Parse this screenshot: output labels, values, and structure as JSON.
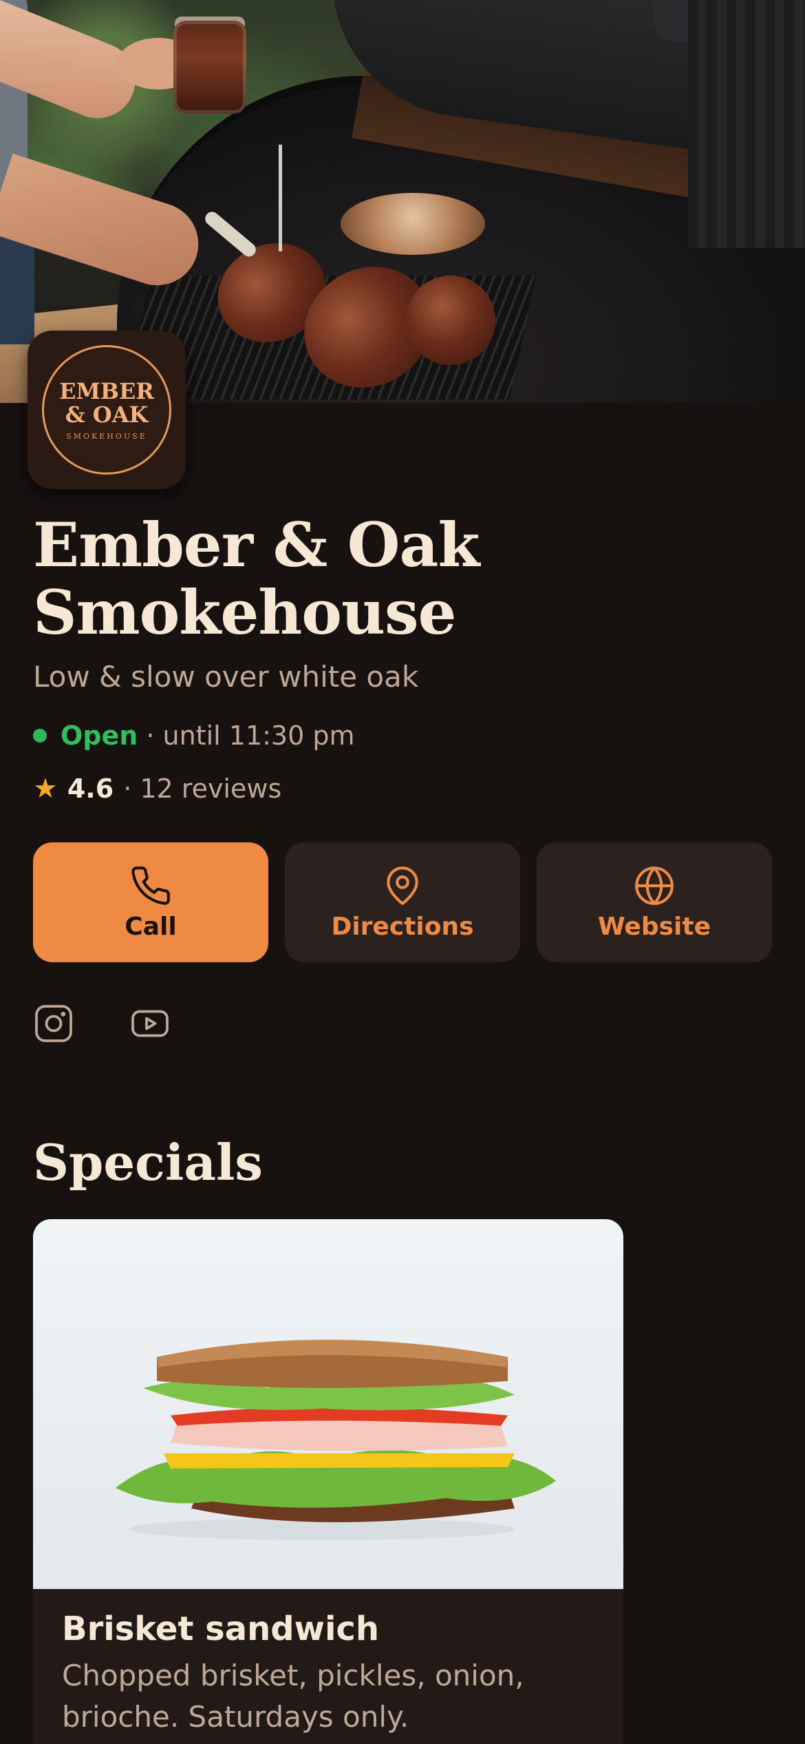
{
  "business": {
    "logo": {
      "line1": "EMBER",
      "line2": "& OAK",
      "line3": "SMOKEHOUSE"
    },
    "name": "Ember & Oak Smokehouse",
    "tagline": "Low & slow over white oak",
    "status": {
      "state": "Open",
      "detail": "· until 11:30 pm",
      "color": "#2fbf5e"
    },
    "rating": {
      "score": "4.6",
      "reviews": "· 12 reviews",
      "star_color": "#f5a623"
    }
  },
  "actions": [
    {
      "label": "Call",
      "icon": "phone-icon"
    },
    {
      "label": "Directions",
      "icon": "map-pin-icon"
    },
    {
      "label": "Website",
      "icon": "globe-icon"
    }
  ],
  "socials": [
    {
      "icon": "instagram-icon"
    },
    {
      "icon": "youtube-icon"
    }
  ],
  "specials": {
    "heading": "Specials",
    "items": [
      {
        "title": "Brisket sandwich",
        "description": "Chopped brisket, pickles, onion, brioche. Saturdays only."
      }
    ]
  },
  "theme": {
    "accent": "#ef8a44",
    "background": "#171110",
    "card": "#2b2220"
  }
}
